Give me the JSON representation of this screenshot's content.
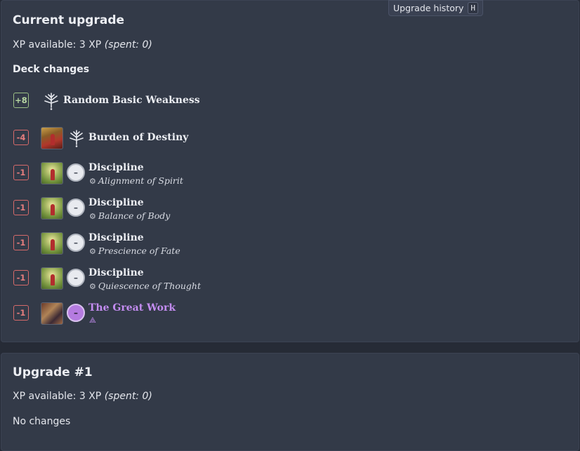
{
  "history": {
    "label": "Upgrade history",
    "shortcut": "H"
  },
  "current": {
    "title": "Current upgrade",
    "xp_text": "XP available: 3 XP",
    "spent_text": "(spent: 0)",
    "deck_changes_label": "Deck changes",
    "rows": [
      {
        "qty": "+8",
        "title": "Random Basic Weakness",
        "subtitle": ""
      },
      {
        "qty": "-4",
        "title": "Burden of Destiny",
        "subtitle": ""
      },
      {
        "qty": "-1",
        "title": "Discipline",
        "subtitle": "Alignment of Spirit",
        "slot": "–"
      },
      {
        "qty": "-1",
        "title": "Discipline",
        "subtitle": "Balance of Body",
        "slot": "–"
      },
      {
        "qty": "-1",
        "title": "Discipline",
        "subtitle": "Prescience of Fate",
        "slot": "–"
      },
      {
        "qty": "-1",
        "title": "Discipline",
        "subtitle": "Quiescence of Thought",
        "slot": "–"
      },
      {
        "qty": "-1",
        "title": "The Great Work",
        "subtitle": "⟁",
        "slot": "–"
      }
    ],
    "gear_glyph": "⚙"
  },
  "upgrade1": {
    "title": "Upgrade #1",
    "xp_text": "XP available: 3 XP",
    "spent_text": "(spent: 0)",
    "no_changes": "No changes"
  },
  "colors": {
    "background": "#262b36",
    "panel": "#333a48",
    "positive": "#b8d7a3",
    "negative": "#e57e7e",
    "mystic_purple": "#c38cf0"
  },
  "icons": {
    "weakness": "weakness-icon",
    "slot": "slot-icon",
    "gear": "gear-icon"
  }
}
